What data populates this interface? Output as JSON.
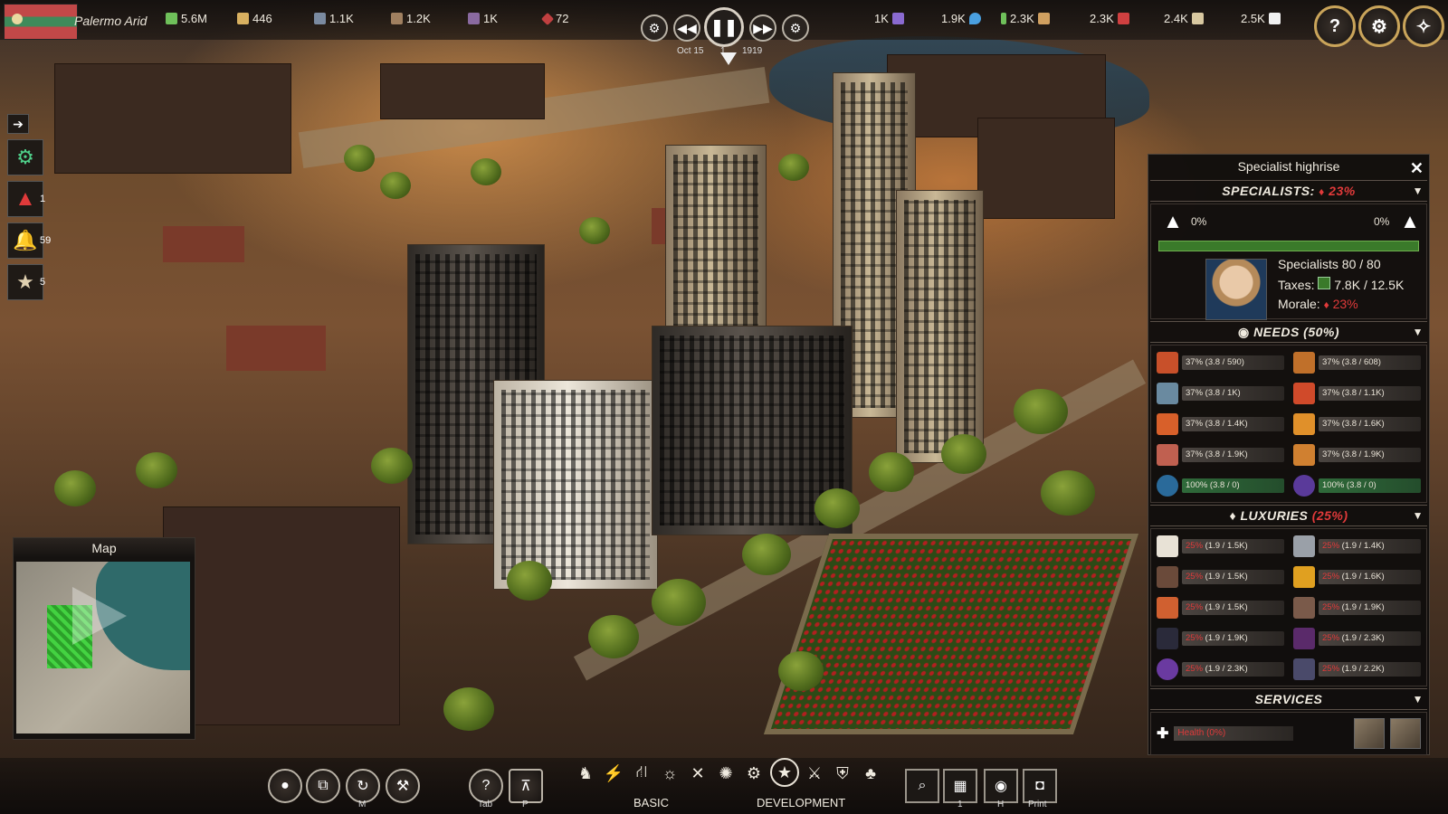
{
  "city": {
    "name": "Palermo Arid",
    "flag_colors": [
      "#c24848",
      "#3f8a5a"
    ]
  },
  "resources_left": [
    {
      "icon": "money-icon",
      "value": "5.6M",
      "color": "#6fc05a"
    },
    {
      "icon": "population-icon",
      "value": "446",
      "color": "#d8b060"
    },
    {
      "icon": "workers-icon",
      "value": "1.1K",
      "color": "#7a8aa0"
    },
    {
      "icon": "farmers-icon",
      "value": "1.2K",
      "color": "#a08060"
    },
    {
      "icon": "engineers-icon",
      "value": "1K",
      "color": "#8a6aa0"
    },
    {
      "icon": "luxury-gem-icon",
      "value": "72",
      "color": "#c04040"
    }
  ],
  "resources_right": [
    {
      "icon": "power-icon",
      "value": "1K",
      "color": "#8a6ad0"
    },
    {
      "icon": "water-icon",
      "value": "1.9K",
      "color": "#4aa0e0"
    },
    {
      "icon": "goods-icon",
      "value": "2.3K",
      "color": "#d0a060"
    },
    {
      "icon": "meat-icon",
      "value": "2.3K",
      "color": "#d04040"
    },
    {
      "icon": "bread-icon",
      "value": "2.4K",
      "color": "#d8c8a0"
    },
    {
      "icon": "paper-icon",
      "value": "2.5K",
      "color": "#f0f0f0"
    }
  ],
  "time": {
    "date": "Oct 15",
    "year": "1919",
    "speed": "1"
  },
  "side_alerts": [
    {
      "name": "expand-icon",
      "count": ""
    },
    {
      "name": "help-gear-icon",
      "count": ""
    },
    {
      "name": "warning-icon",
      "count": "1"
    },
    {
      "name": "notification-bell-icon",
      "count": "59"
    },
    {
      "name": "achievement-star-icon",
      "count": "5"
    }
  ],
  "minimap": {
    "title": "Map"
  },
  "panel": {
    "title": "Specialist highrise",
    "specialists": {
      "label": "SPECIALISTS:",
      "morale_pct": "23%",
      "fire_risk": "0%",
      "crime_risk": "0%",
      "bar_fill": 1.0,
      "count_line": "Specialists 80 / 80",
      "taxes_label": "Taxes:",
      "taxes_value": "7.8K / 12.5K",
      "morale_label": "Morale:",
      "morale_value": "23%"
    },
    "needs": {
      "title": "NEEDS (50%)",
      "items": [
        {
          "icon": "salad-icon",
          "text": "37% (3.8 / 590)",
          "full": false
        },
        {
          "icon": "bread-loaf-icon",
          "text": "37% (3.8 / 608)",
          "full": false
        },
        {
          "icon": "fish-icon",
          "text": "37% (3.8 / 1K)",
          "full": false
        },
        {
          "icon": "steak-icon",
          "text": "37% (3.8 / 1.1K)",
          "full": false
        },
        {
          "icon": "soup-icon",
          "text": "37% (3.8 / 1.4K)",
          "full": false
        },
        {
          "icon": "juice-icon",
          "text": "37% (3.8 / 1.6K)",
          "full": false
        },
        {
          "icon": "sushi-icon",
          "text": "37% (3.8 / 1.9K)",
          "full": false
        },
        {
          "icon": "pie-icon",
          "text": "37% (3.8 / 1.9K)",
          "full": false
        },
        {
          "icon": "water-drop-icon",
          "text": "100% (3.8 / 0)",
          "full": true
        },
        {
          "icon": "electricity-icon",
          "text": "100% (3.8 / 0)",
          "full": true
        }
      ]
    },
    "luxuries": {
      "title": "LUXURIES",
      "pct": "(25%)",
      "items": [
        {
          "icon": "clothes-icon",
          "pct": "25%",
          "rest": " (1.9 / 1.5K)"
        },
        {
          "icon": "shoes-icon",
          "pct": "25%",
          "rest": " (1.9 / 1.4K)"
        },
        {
          "icon": "coffee-icon",
          "pct": "25%",
          "rest": " (1.9 / 1.5K)"
        },
        {
          "icon": "beer-icon",
          "pct": "25%",
          "rest": " (1.9 / 1.6K)"
        },
        {
          "icon": "radio-icon",
          "pct": "25%",
          "rest": " (1.9 / 1.5K)"
        },
        {
          "icon": "chemicals-icon",
          "pct": "25%",
          "rest": " (1.9 / 1.9K)"
        },
        {
          "icon": "suit-icon",
          "pct": "25%",
          "rest": " (1.9 / 1.9K)"
        },
        {
          "icon": "dress-icon",
          "pct": "25%",
          "rest": " (1.9 / 2.3K)"
        },
        {
          "icon": "perfume-icon",
          "pct": "25%",
          "rest": " (1.9 / 2.3K)"
        },
        {
          "icon": "jewelry-icon",
          "pct": "25%",
          "rest": " (1.9 / 2.2K)"
        }
      ]
    },
    "services": {
      "title": "SERVICES",
      "health_label": "Health (0%)"
    }
  },
  "bottom": {
    "left_buttons": [
      {
        "name": "demolish-button",
        "icon": "💣",
        "key": ""
      },
      {
        "name": "copy-button",
        "icon": "⧉",
        "key": ""
      },
      {
        "name": "move-button",
        "icon": "↻",
        "key": "M"
      },
      {
        "name": "tools-button",
        "icon": "⚒",
        "key": ""
      }
    ],
    "mid_buttons": [
      {
        "name": "help-button",
        "icon": "?",
        "key": "Tab"
      },
      {
        "name": "blueprint-button",
        "icon": "⊼",
        "key": "P"
      }
    ],
    "categories": [
      {
        "name": "livestock-icon",
        "glyph": "♞"
      },
      {
        "name": "power-plug-icon",
        "glyph": "⚡"
      },
      {
        "name": "roads-icon",
        "glyph": "⛙"
      },
      {
        "name": "weather-icon",
        "glyph": "☼"
      },
      {
        "name": "industry-tools-icon",
        "glyph": "✕"
      },
      {
        "name": "settlement-icon",
        "glyph": "✺"
      },
      {
        "name": "factory-icon",
        "glyph": "⚙"
      },
      {
        "name": "government-star-icon",
        "glyph": "★"
      },
      {
        "name": "mining-icon",
        "glyph": "⚔"
      },
      {
        "name": "police-badge-icon",
        "glyph": "⛨"
      },
      {
        "name": "nature-tree-icon",
        "glyph": "♣"
      }
    ],
    "tabs": [
      "BASIC",
      "DEVELOPMENT"
    ],
    "right_buttons": [
      {
        "name": "inspect-zoom-button",
        "icon": "⌕",
        "key": ""
      },
      {
        "name": "districts-button",
        "icon": "▦",
        "key": "1"
      },
      {
        "name": "overlays-eye-button",
        "icon": "👁",
        "key": "H"
      },
      {
        "name": "screenshot-camera-button",
        "icon": "📷",
        "key": "Print"
      }
    ]
  }
}
